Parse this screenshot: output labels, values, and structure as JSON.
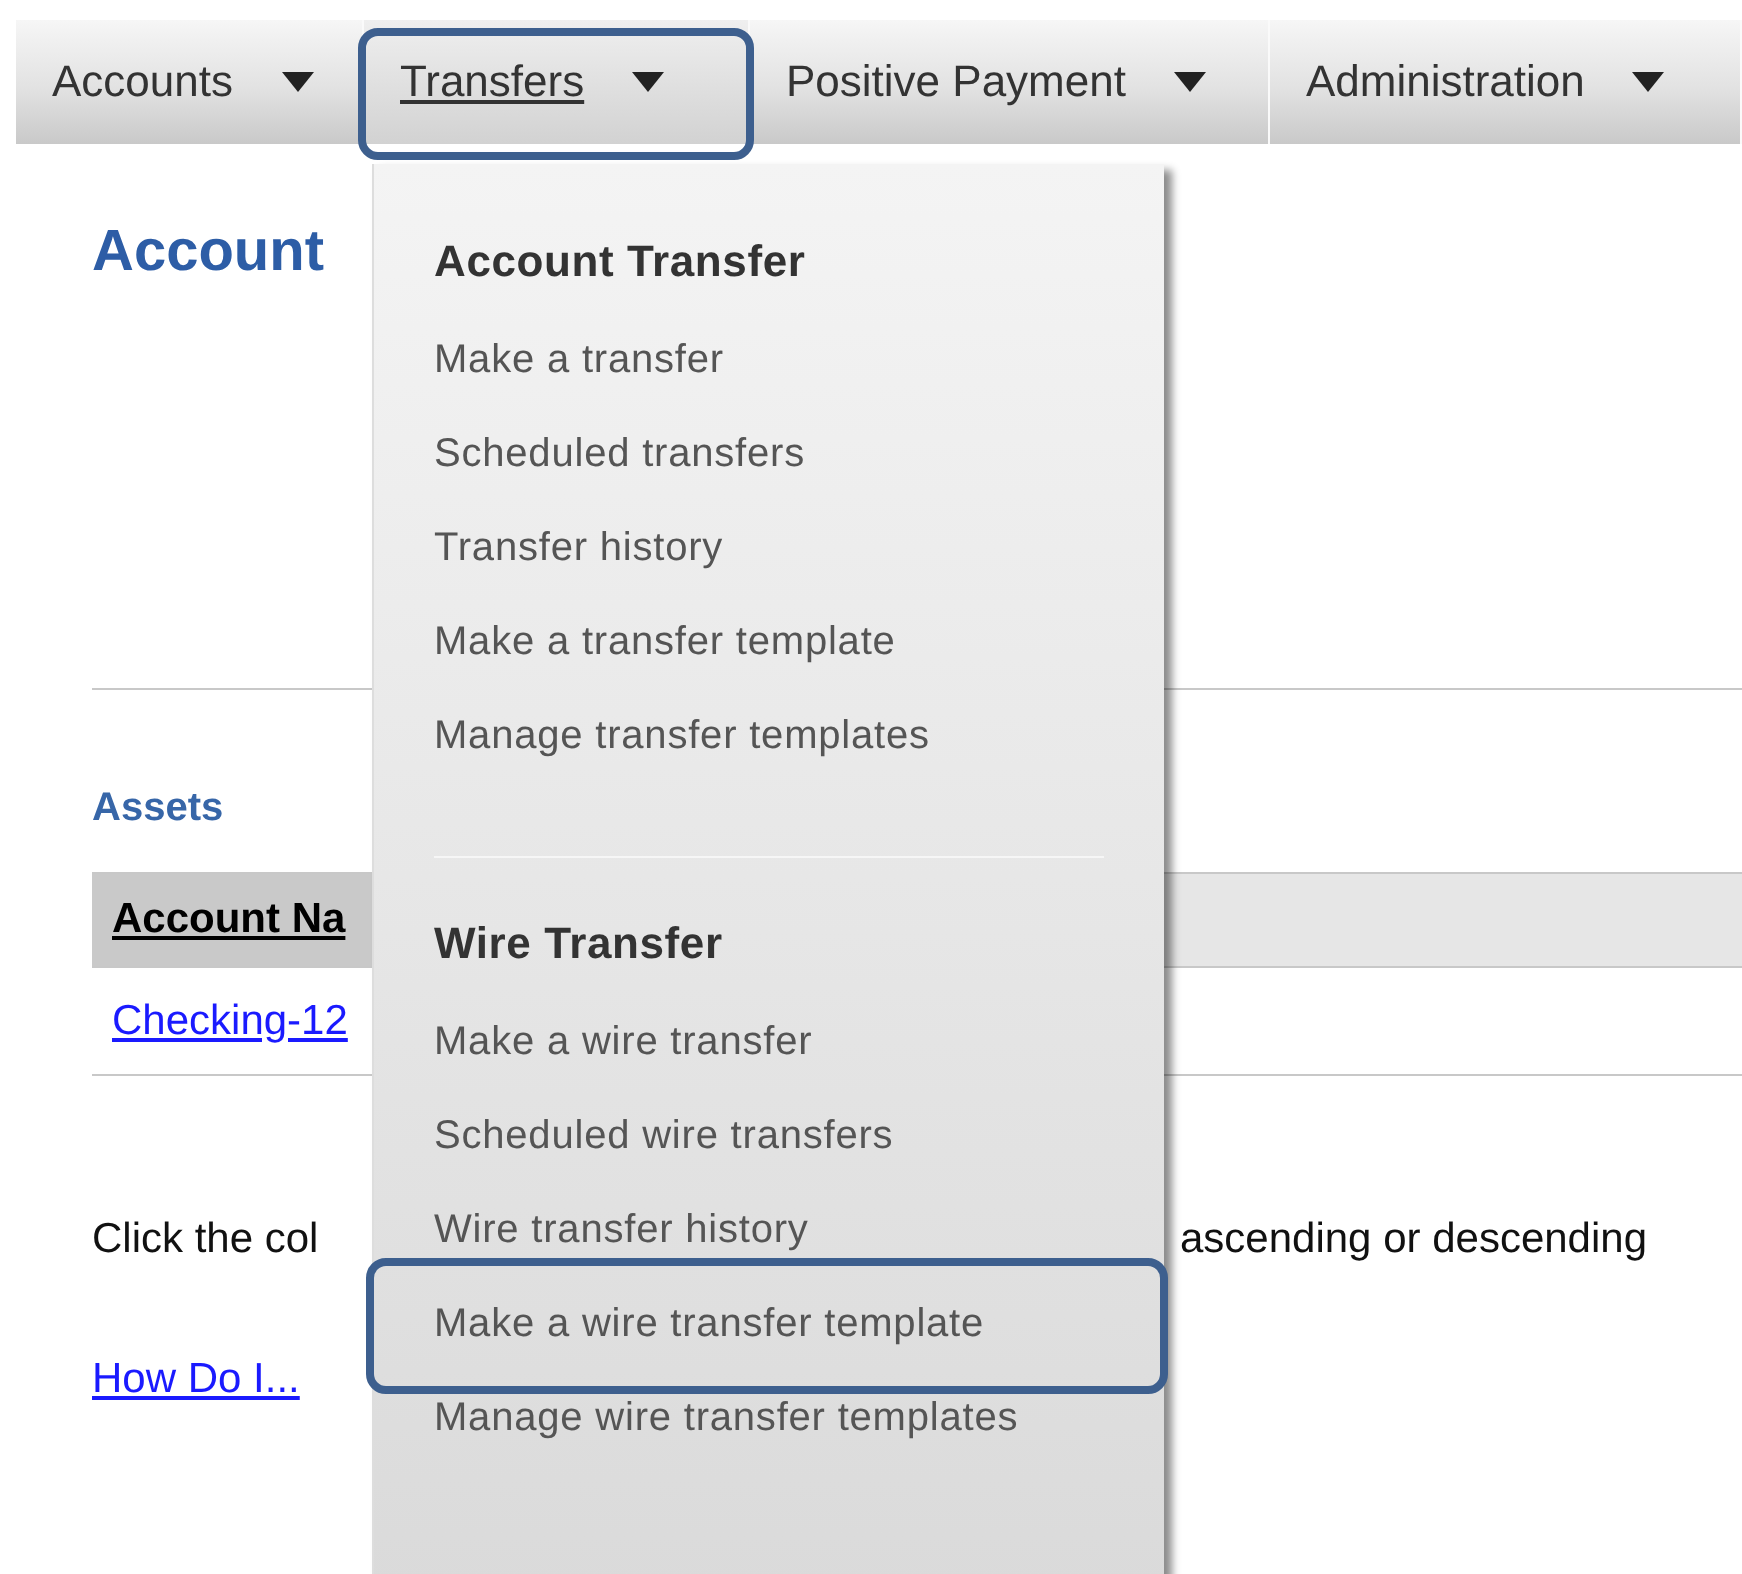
{
  "nav": {
    "tabs": [
      {
        "label": "Accounts",
        "selected": false,
        "highlighted": false
      },
      {
        "label": "Transfers",
        "selected": true,
        "highlighted": true
      },
      {
        "label": "Positive Payment",
        "selected": false,
        "highlighted": false
      },
      {
        "label": "Administration",
        "selected": false,
        "highlighted": false
      }
    ]
  },
  "page": {
    "title": "Account",
    "section": "Assets",
    "table_header": "Account Na",
    "row_link": "Checking-12",
    "help_left": "Click the col",
    "help_right": "ascending or descending",
    "help_link": "How Do I..."
  },
  "menu": {
    "groups": [
      {
        "heading": "Account Transfer",
        "items": [
          {
            "label": "Make a transfer",
            "highlighted": false
          },
          {
            "label": "Scheduled transfers",
            "highlighted": false
          },
          {
            "label": "Transfer history",
            "highlighted": false
          },
          {
            "label": "Make a transfer template",
            "highlighted": false
          },
          {
            "label": "Manage transfer templates",
            "highlighted": false
          }
        ]
      },
      {
        "heading": "Wire Transfer",
        "items": [
          {
            "label": "Make a wire transfer",
            "highlighted": false
          },
          {
            "label": "Scheduled wire transfers",
            "highlighted": false
          },
          {
            "label": "Wire transfer history",
            "highlighted": false
          },
          {
            "label": "Make a wire transfer template",
            "highlighted": true
          },
          {
            "label": "Manage wire transfer templates",
            "highlighted": false
          }
        ]
      }
    ]
  }
}
